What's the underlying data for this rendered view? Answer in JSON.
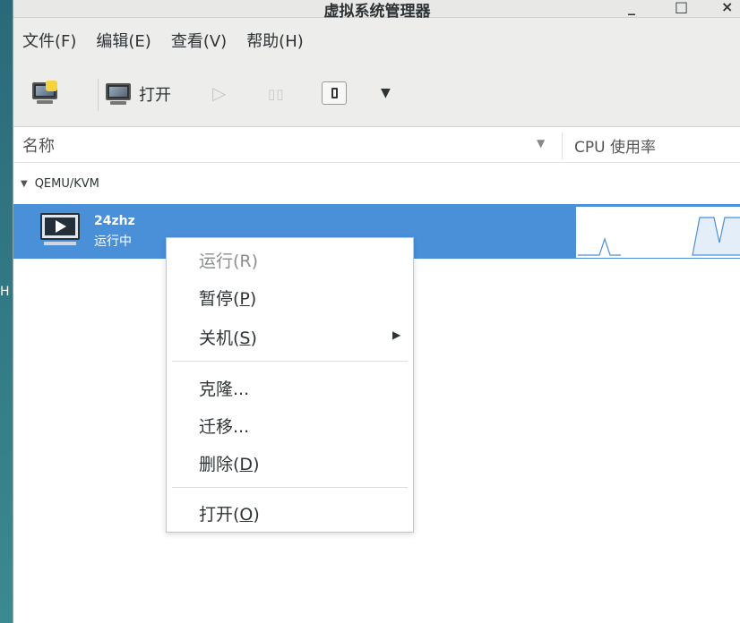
{
  "desktop": {
    "edge_letter": "H"
  },
  "window": {
    "title": "虚拟系统管理器",
    "controls": {
      "minimize": "_",
      "maximize": "□",
      "close": "×"
    }
  },
  "menubar": {
    "items": [
      "文件(F)",
      "编辑(E)",
      "查看(V)",
      "帮助(H)"
    ]
  },
  "toolbar": {
    "open_label": "打开",
    "icons": [
      "new-vm-icon",
      "open-console-icon",
      "play-icon",
      "pause-icon",
      "shutdown-icon",
      "chevron-down-icon"
    ]
  },
  "columns": {
    "name": "名称",
    "cpu": "CPU 使用率"
  },
  "connection": {
    "name": "QEMU/KVM"
  },
  "vm": {
    "name": "24zhz",
    "status": "运行中"
  },
  "context_menu": {
    "run": "运行(R)",
    "pause_pre": "暂停(",
    "pause_key": "P",
    "pause_post": ")",
    "shutdown_pre": "关机(",
    "shutdown_key": "S",
    "shutdown_post": ")",
    "clone": "克隆...",
    "migrate": "迁移...",
    "delete_pre": "删除(",
    "delete_key": "D",
    "delete_post": ")",
    "open_pre": "打开(",
    "open_key": "O",
    "open_post": ")"
  },
  "colors": {
    "selection": "#4a90d9",
    "cpu_line": "#4a90d9"
  }
}
